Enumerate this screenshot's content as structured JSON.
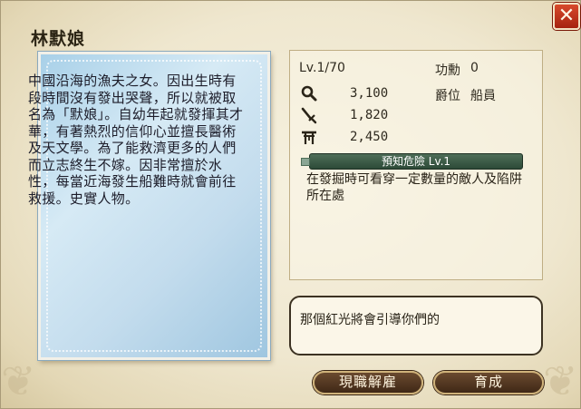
{
  "window": {
    "close_label": "✕"
  },
  "character": {
    "name": "林默娘",
    "bio": "中國沿海的漁夫之女。因出生時有段時間沒有發出哭聲，所以就被取名為「默娘」。自幼年起就發揮其才華，有著熱烈的信仰心並擅長醫術及天文學。為了能救濟更多的人們而立志終生不嫁。因非常擅於水性，每當近海發生船難時就會前往救援。史實人物。"
  },
  "stats": {
    "level": "Lv.1/70",
    "merit_label": "功勳",
    "merit_value": "0",
    "rank_label": "爵位",
    "rank_value": "船員",
    "rows": [
      {
        "icon": "magnifier-icon",
        "value": "3,100"
      },
      {
        "icon": "sword-icon",
        "value": "1,820"
      },
      {
        "icon": "shrine-icon",
        "value": "2,450"
      }
    ]
  },
  "skill": {
    "name": "預知危險 Lv.1",
    "description": "在發掘時可看穿一定數量的敵人及陷阱所在處"
  },
  "dialog": {
    "text": "那個紅光將會引導你們的"
  },
  "buttons": {
    "dismiss": "現職解雇",
    "train": "育成"
  },
  "colors": {
    "accent": "#3f2816",
    "skill_bar": "#2d4a38",
    "close": "#c0331b"
  }
}
